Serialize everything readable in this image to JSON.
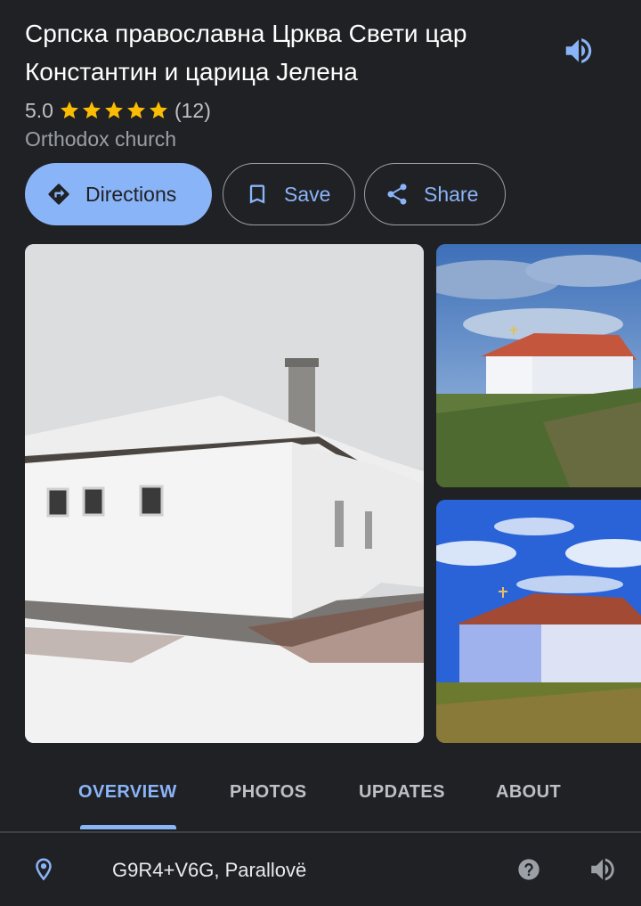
{
  "place": {
    "title": "Српска православна Црква Свети цар Константин и царица Јелена",
    "rating": "5.0",
    "review_count": "(12)",
    "stars_filled": 5,
    "category": "Orthodox church"
  },
  "actions": {
    "directions_label": "Directions",
    "save_label": "Save",
    "share_label": "Share"
  },
  "tabs": [
    {
      "label": "OVERVIEW",
      "active": true
    },
    {
      "label": "PHOTOS",
      "active": false
    },
    {
      "label": "UPDATES",
      "active": false
    },
    {
      "label": "ABOUT",
      "active": false
    }
  ],
  "location": {
    "plus_code": "G9R4+V6G, Parallovë"
  },
  "colors": {
    "background": "#202124",
    "accent": "#8ab4f8",
    "star": "#fbbc04",
    "text_primary": "#ffffff",
    "text_secondary": "#9aa0a6"
  },
  "icons": {
    "read_aloud": "speaker-icon",
    "directions": "directions-icon",
    "save": "bookmark-icon",
    "share": "share-icon",
    "location": "location-pin-icon",
    "help": "help-icon"
  }
}
